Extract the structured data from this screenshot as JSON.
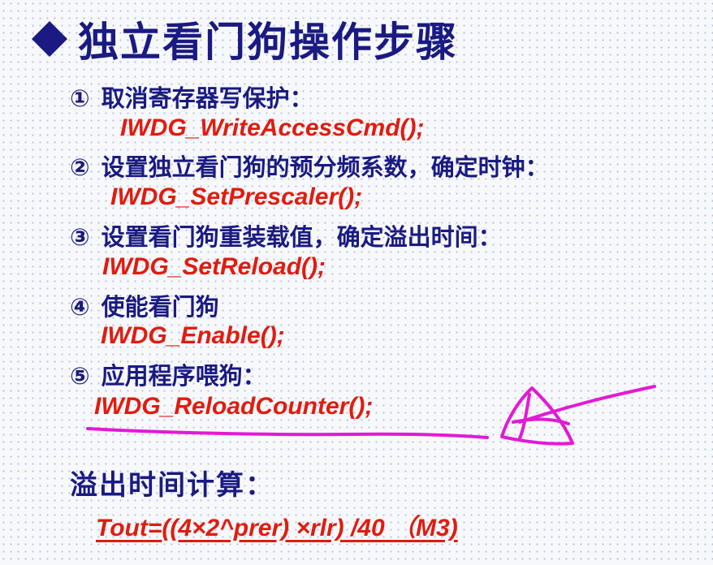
{
  "title": {
    "text": "独立看门狗操作步骤"
  },
  "steps": [
    {
      "num": "①",
      "label": "取消寄存器写保护：",
      "code": "IWDG_WriteAccessCmd();"
    },
    {
      "num": "②",
      "label": "设置独立看门狗的预分频系数，确定时钟：",
      "code": "IWDG_SetPrescaler();"
    },
    {
      "num": "③",
      "label": "设置看门狗重装载值，确定溢出时间：",
      "code": "IWDG_SetReload();"
    },
    {
      "num": "④",
      "label": "使能看门狗",
      "code": "IWDG_Enable();"
    },
    {
      "num": "⑤",
      "label": "应用程序喂狗：",
      "code": "IWDG_ReloadCounter();"
    }
  ],
  "calc": {
    "title": "溢出时间计算：",
    "formula": "Tout=((4×2^prer) ×rlr) /40  （M3)"
  },
  "colors": {
    "title": "#1a1a82",
    "code": "#e01c0e",
    "annotation": "#e21ad6"
  }
}
